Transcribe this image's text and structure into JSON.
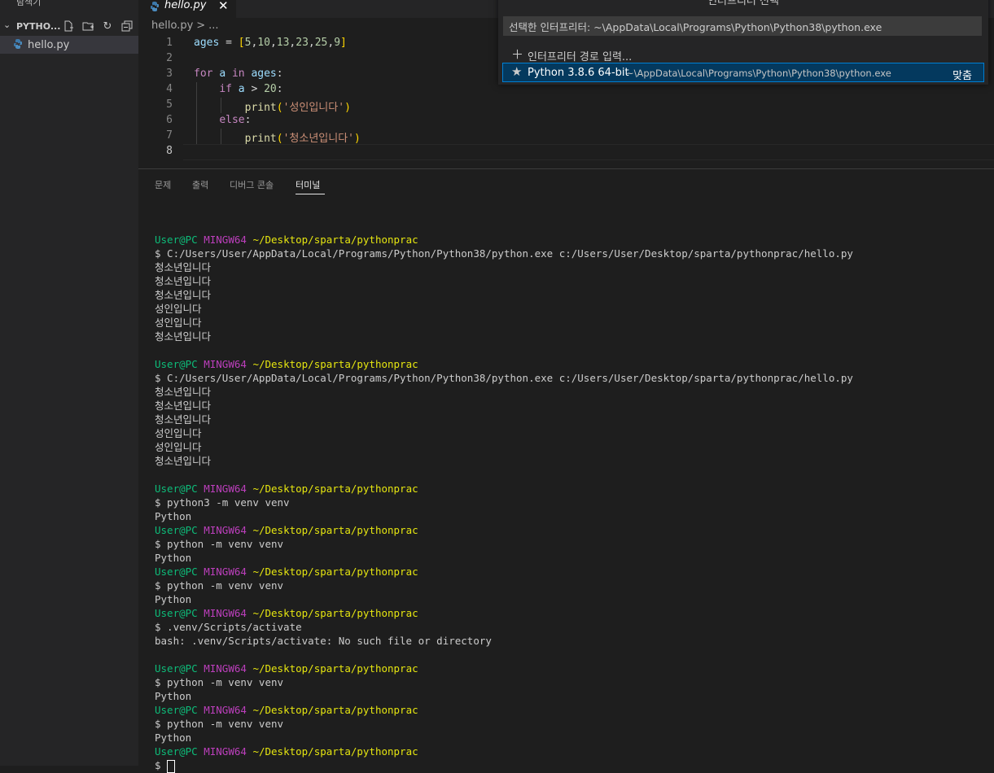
{
  "sidebar": {
    "title": "탐색기",
    "more": "···",
    "section": "PYTHO...",
    "files": [
      {
        "name": "hello.py"
      }
    ]
  },
  "tab": {
    "label": "hello.py",
    "close": "✕"
  },
  "breadcrumb": [
    "hello.py",
    ">",
    "..."
  ],
  "editor": {
    "line_numbers": [
      "1",
      "2",
      "3",
      "4",
      "5",
      "6",
      "7",
      "8"
    ],
    "current_line": "8"
  },
  "panel": {
    "tabs": [
      "문제",
      "출력",
      "디버그 콘솔",
      "터미널"
    ],
    "active_tab": "터미널"
  },
  "terminal": {
    "user": "User@PC",
    "host": "MINGW64",
    "path": "~/Desktop/sparta/pythonprac",
    "lines": [
      {
        "type": "blank"
      },
      {
        "type": "prompt"
      },
      {
        "type": "text",
        "text": "$ C:/Users/User/AppData/Local/Programs/Python/Python38/python.exe c:/Users/User/Desktop/sparta/pythonprac/hello.py"
      },
      {
        "type": "text",
        "text": "청소년입니다"
      },
      {
        "type": "text",
        "text": "청소년입니다"
      },
      {
        "type": "text",
        "text": "청소년입니다"
      },
      {
        "type": "text",
        "text": "성인입니다"
      },
      {
        "type": "text",
        "text": "성인입니다"
      },
      {
        "type": "text",
        "text": "청소년입니다"
      },
      {
        "type": "blank"
      },
      {
        "type": "prompt"
      },
      {
        "type": "text",
        "text": "$ C:/Users/User/AppData/Local/Programs/Python/Python38/python.exe c:/Users/User/Desktop/sparta/pythonprac/hello.py"
      },
      {
        "type": "text",
        "text": "청소년입니다"
      },
      {
        "type": "text",
        "text": "청소년입니다"
      },
      {
        "type": "text",
        "text": "청소년입니다"
      },
      {
        "type": "text",
        "text": "성인입니다"
      },
      {
        "type": "text",
        "text": "성인입니다"
      },
      {
        "type": "text",
        "text": "청소년입니다"
      },
      {
        "type": "blank"
      },
      {
        "type": "prompt"
      },
      {
        "type": "text",
        "text": "$ python3 -m venv venv"
      },
      {
        "type": "text",
        "text": "Python"
      },
      {
        "type": "prompt"
      },
      {
        "type": "text",
        "text": "$ python -m venv venv"
      },
      {
        "type": "text",
        "text": "Python"
      },
      {
        "type": "prompt"
      },
      {
        "type": "text",
        "text": "$ python -m venv venv"
      },
      {
        "type": "text",
        "text": "Python"
      },
      {
        "type": "prompt"
      },
      {
        "type": "text",
        "text": "$ .venv/Scripts/activate"
      },
      {
        "type": "text",
        "text": "bash: .venv/Scripts/activate: No such file or directory"
      },
      {
        "type": "blank"
      },
      {
        "type": "prompt"
      },
      {
        "type": "text",
        "text": "$ python -m venv venv"
      },
      {
        "type": "text",
        "text": "Python"
      },
      {
        "type": "prompt"
      },
      {
        "type": "text",
        "text": "$ python -m venv venv"
      },
      {
        "type": "text",
        "text": "Python"
      },
      {
        "type": "prompt"
      },
      {
        "type": "cursor",
        "text": "$ "
      }
    ]
  },
  "quickpick": {
    "title": "인터프리터 선택",
    "input_value": "선택한 인터프리터: ~\\AppData\\Local\\Programs\\Python\\Python38\\python.exe",
    "items": [
      {
        "icon": "plus-icon",
        "glyph": "＋",
        "label": "인터프리터 경로 입력..."
      },
      {
        "icon": "star-icon",
        "glyph": "★",
        "label": "Python 3.8.6 64-bit",
        "description": "~\\AppData\\Local\\Programs\\Python\\Python38\\python.exe",
        "detail": "맞춤"
      }
    ]
  },
  "colors": {
    "accent": "#007fd4",
    "selection": "#04395e",
    "terminal_user": "#0dbc79",
    "terminal_host": "#bc3fbc",
    "terminal_path": "#e5e510"
  }
}
